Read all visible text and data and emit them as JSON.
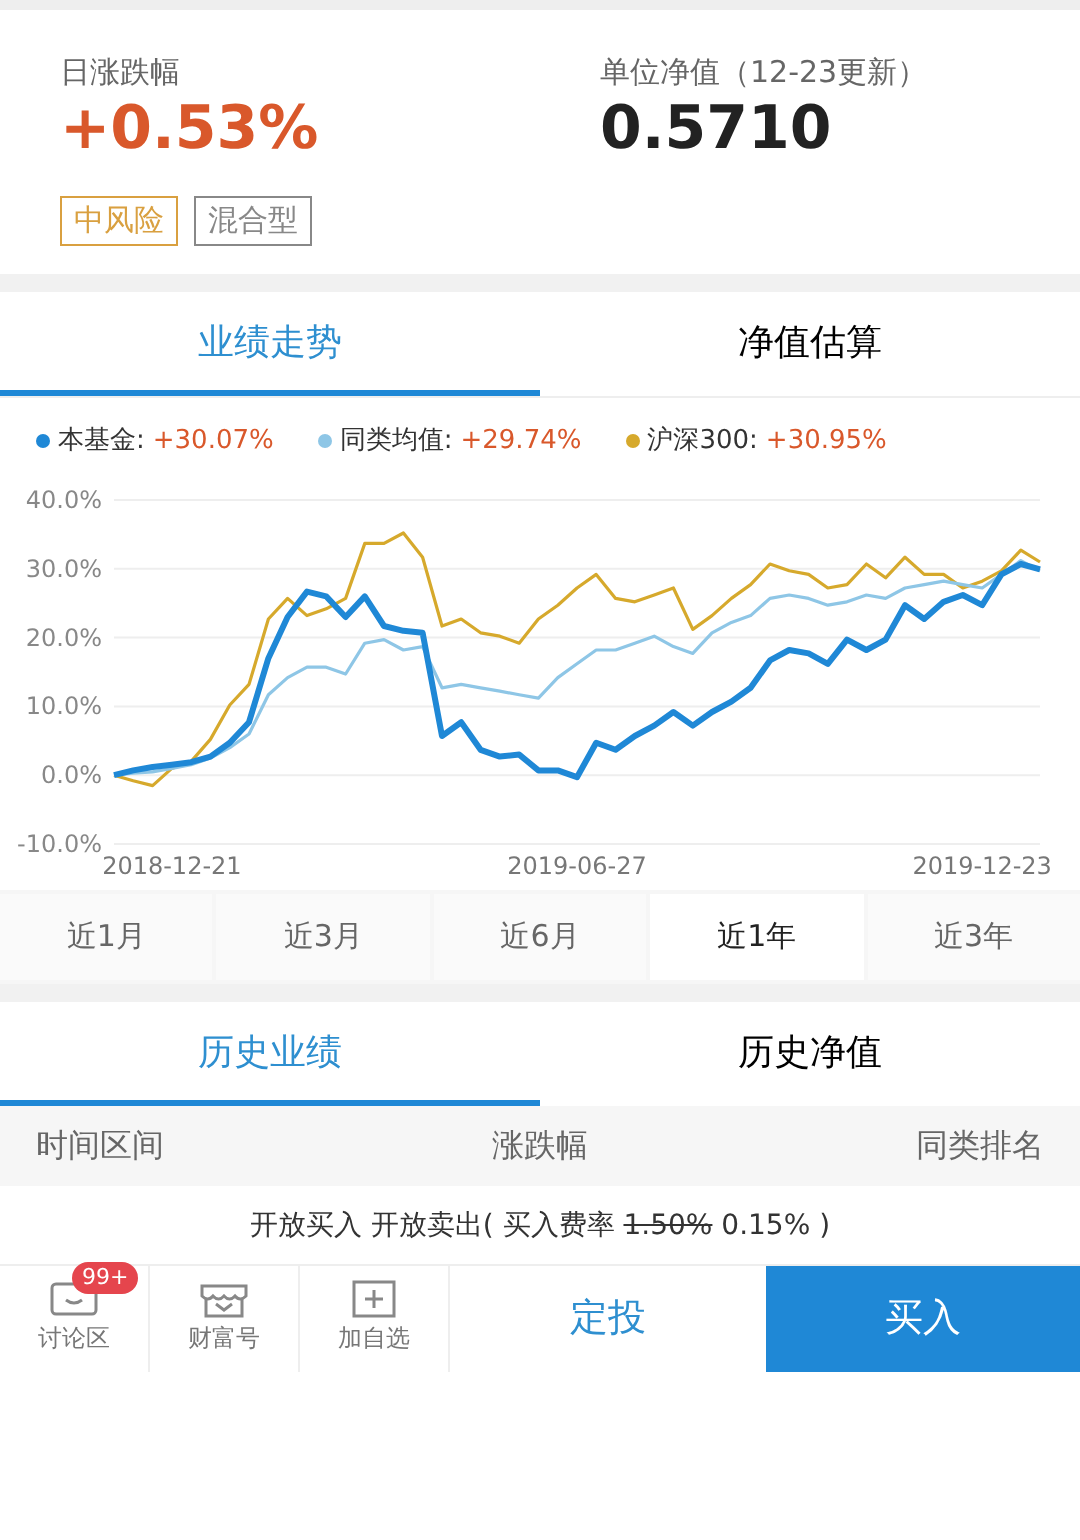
{
  "summary": {
    "change_label": "日涨跌幅",
    "change_value": "+0.53%",
    "nav_label": "单位净值（12-23更新）",
    "nav_value": "0.5710"
  },
  "tags": [
    {
      "label": "中风险",
      "color": "#d9a040"
    },
    {
      "label": "混合型",
      "color": "#888888"
    }
  ],
  "chart_tabs": [
    {
      "label": "业绩走势",
      "selected": true
    },
    {
      "label": "净值估算",
      "selected": false
    }
  ],
  "legend": [
    {
      "value": "+30.07%"
    },
    {
      "value": "+29.74%"
    },
    {
      "value": "+30.95%"
    }
  ],
  "chart_data": {
    "type": "line",
    "grid": true,
    "categories": [
      null,
      null,
      null,
      "2018-12-21",
      null,
      null,
      null,
      null,
      null,
      null,
      null,
      null,
      null,
      null,
      null,
      null,
      null,
      null,
      null,
      null,
      null,
      null,
      null,
      null,
      "2019-06-27",
      null,
      null,
      null,
      null,
      null,
      null,
      null,
      null,
      null,
      null,
      null,
      null,
      null,
      null,
      null,
      null,
      null,
      null,
      null,
      null,
      "2019-12-23",
      null,
      null,
      null
    ],
    "ylim": [
      -10,
      40
    ],
    "yticks": [
      {
        "value": -10,
        "label": "-10.0%"
      },
      {
        "value": 0,
        "label": "0.0%"
      },
      {
        "value": 10,
        "label": "10.0%"
      },
      {
        "value": 20,
        "label": "20.0%"
      },
      {
        "value": 30,
        "label": "30.0%"
      },
      {
        "value": 40,
        "label": "40.0%"
      }
    ],
    "series": [
      {
        "name": "本基金:",
        "color": "#1f88d6",
        "values": [
          0,
          0.7,
          1.2,
          1.5,
          1.9,
          2.7,
          4.7,
          7.7,
          17,
          23,
          26.7,
          26,
          23,
          26,
          21.7,
          21,
          20.7,
          5.7,
          7.7,
          3.7,
          2.7,
          3,
          0.7,
          0.7,
          -0.3,
          4.7,
          3.7,
          5.7,
          7.2,
          9.2,
          7.2,
          9.2,
          10.7,
          12.7,
          16.7,
          18.2,
          17.7,
          16.2,
          19.7,
          18.2,
          19.7,
          24.7,
          22.7,
          25.2,
          26.2,
          24.7,
          29.2,
          30.7,
          29.9
        ]
      },
      {
        "name": "同类均值:",
        "color": "#8ec6e6",
        "values": [
          0,
          0.3,
          0.5,
          1,
          1.5,
          2.5,
          4,
          6,
          11.7,
          14.2,
          15.7,
          15.7,
          14.7,
          19.2,
          19.7,
          18.2,
          18.7,
          12.7,
          13.2,
          12.7,
          12.2,
          11.7,
          11.2,
          14.2,
          16.2,
          18.2,
          18.2,
          19.2,
          20.2,
          18.7,
          17.7,
          20.7,
          22.2,
          23.2,
          25.7,
          26.2,
          25.7,
          24.7,
          25.2,
          26.2,
          25.7,
          27.2,
          27.7,
          28.2,
          27.7,
          27.2,
          29.2,
          31.2,
          29.7
        ]
      },
      {
        "name": "沪深300:",
        "color": "#d6a92c",
        "values": [
          0,
          -0.8,
          -1.5,
          1,
          2,
          5.2,
          10.2,
          13.2,
          22.7,
          25.7,
          23.2,
          24.2,
          25.7,
          33.7,
          33.7,
          35.2,
          31.7,
          21.7,
          22.7,
          20.7,
          20.2,
          19.2,
          22.7,
          24.7,
          27.2,
          29.2,
          25.7,
          25.2,
          26.2,
          27.2,
          21.2,
          23.2,
          25.7,
          27.7,
          30.7,
          29.7,
          29.2,
          27.2,
          27.7,
          30.7,
          28.7,
          31.7,
          29.2,
          29.2,
          27.2,
          28.2,
          29.7,
          32.7,
          31
        ]
      }
    ]
  },
  "periods": [
    {
      "label": "近1月",
      "selected": false
    },
    {
      "label": "近3月",
      "selected": false
    },
    {
      "label": "近6月",
      "selected": false
    },
    {
      "label": "近1年",
      "selected": true
    },
    {
      "label": "近3年",
      "selected": false
    }
  ],
  "history_tabs": [
    {
      "label": "历史业绩",
      "selected": true
    },
    {
      "label": "历史净值",
      "selected": false
    }
  ],
  "columns": [
    "时间区间",
    "涨跌幅",
    "同类排名"
  ],
  "note": {
    "text": "开放买入 开放卖出( 买入费率",
    "old_rate": "1.50%",
    "new_rate": "0.15%",
    "close": ")"
  },
  "bottom_bar": {
    "items": [
      {
        "kind": "chat",
        "label": "讨论区",
        "badge": "99+"
      },
      {
        "kind": "store",
        "label": "财富号"
      },
      {
        "kind": "add",
        "label": "加自选"
      }
    ],
    "invest_button": "定投",
    "buy_button": "买入"
  }
}
